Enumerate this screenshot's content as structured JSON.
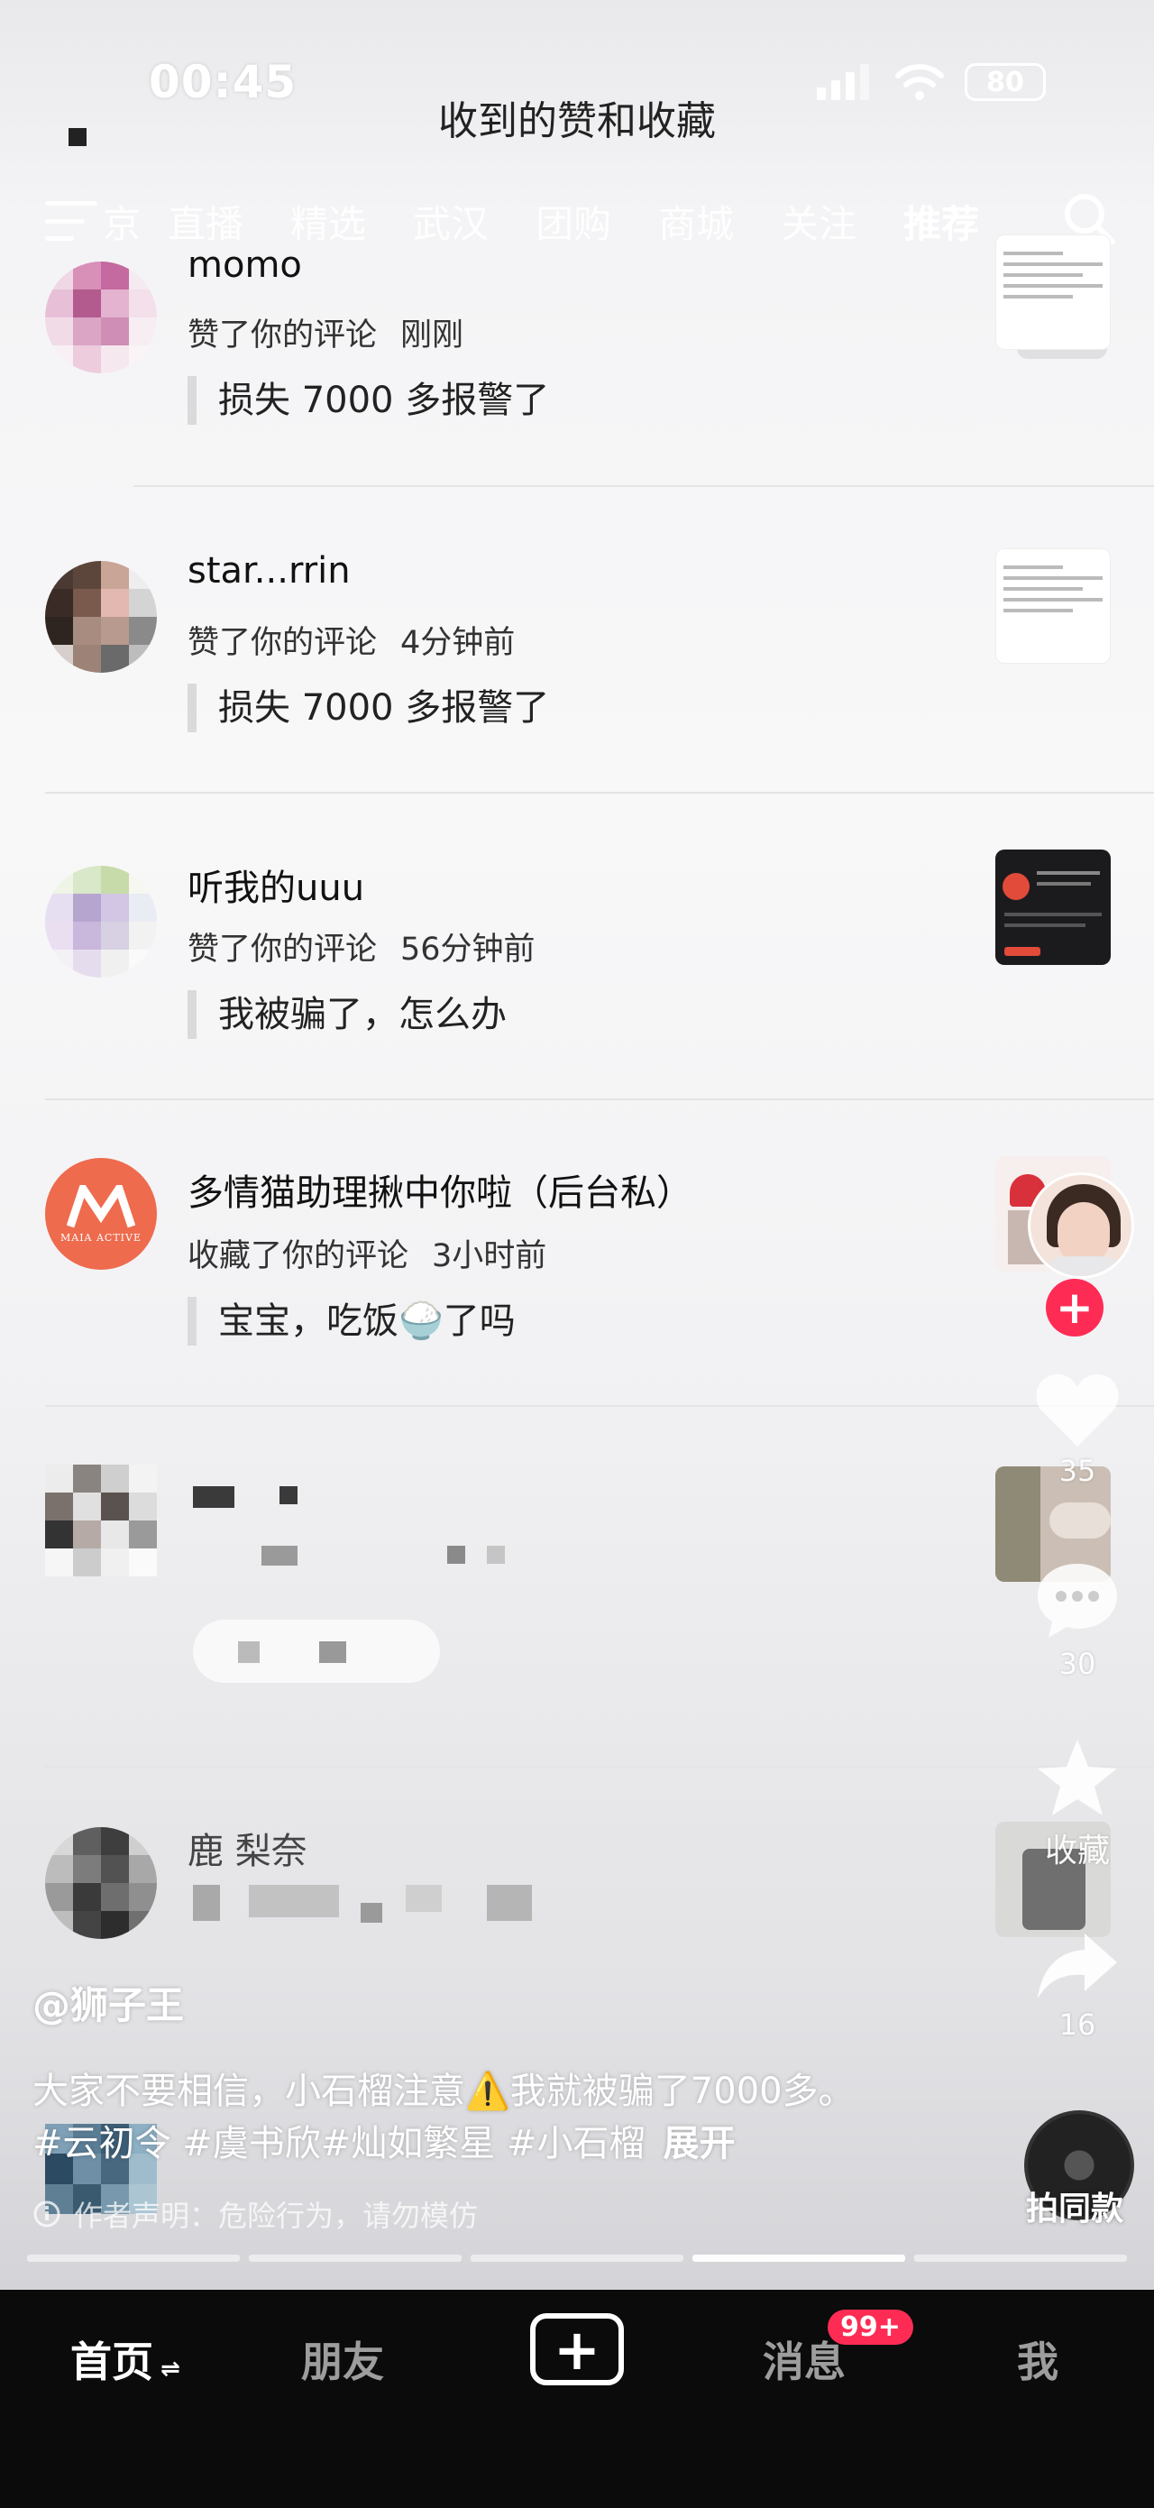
{
  "status_bar": {
    "time": "00:45",
    "battery": "80"
  },
  "page": {
    "title": "收到的赞和收藏"
  },
  "overlay_nav": {
    "tabs": [
      "京",
      "直播",
      "精选",
      "武汉",
      "团购",
      "商城",
      "关注",
      "推荐"
    ],
    "active_tab": "推荐"
  },
  "counter": "4 / 5",
  "notifications": [
    {
      "name": "momo",
      "action": "赞了你的评论",
      "time": "刚刚",
      "quote": "损失 7000 多报警了"
    },
    {
      "name": "star...rrin",
      "action": "赞了你的评论",
      "time": "4分钟前",
      "quote": "损失 7000 多报警了"
    },
    {
      "name": "听我的uuu",
      "action": "赞了你的评论",
      "time": "56分钟前",
      "quote": "我被骗了，怎么办"
    },
    {
      "name": "多情猫助理揪中你啦（后台私）",
      "action": "收藏了你的评论",
      "time": "3小时前",
      "quote": "宝宝，吃饭🍚了吗",
      "avatar_text": "MAIA ACTIVE"
    },
    {
      "name": "",
      "action": "",
      "time": "",
      "quote": ""
    },
    {
      "name": "鹿   梨奈",
      "action": "",
      "time": "",
      "quote": ""
    }
  ],
  "side": {
    "likes": "35",
    "comments": "30",
    "favorite_label": "收藏",
    "shares": "16",
    "shoot_label": "拍同款"
  },
  "caption": {
    "author": "@狮子王",
    "text": "大家不要相信，小石榴注意⚠️我就被骗了7000多。#云初令 #虞书欣#灿如繁星 #小石榴",
    "expand": "展开",
    "note": "作者声明：危险行为，请勿模仿"
  },
  "bottom_nav": {
    "home": "首页",
    "friends": "朋友",
    "plus": "+",
    "messages": "消息",
    "badge": "99+",
    "me": "我"
  },
  "colors": {
    "accent": "#fe2c55",
    "bar": "#0b0b0b"
  }
}
